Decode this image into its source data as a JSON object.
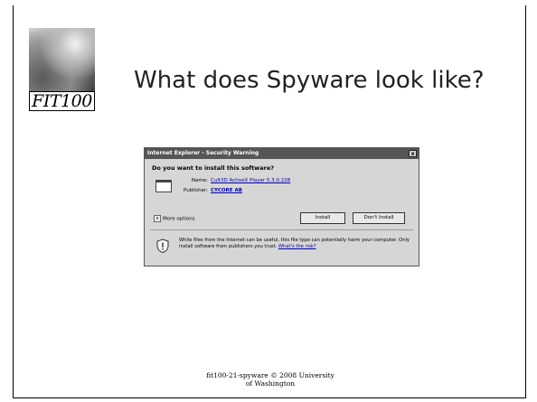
{
  "logo": {
    "text": "FIT100"
  },
  "slide": {
    "title": "What does Spyware look like?"
  },
  "dialog": {
    "title": "Internet Explorer - Security Warning",
    "close_label": "x",
    "question": "Do you want to install this software?",
    "name_label": "Name:",
    "name_value": "Cult3D ActiveX Player 5.3.0.228",
    "publisher_label": "Publisher:",
    "publisher_value": "CYCORE AB",
    "more_options": "More options",
    "install_button": "Install",
    "dont_install_button": "Don't Install",
    "warning_text": "While files from the Internet can be useful, this file type can potentially harm your computer. Only install software from publishers you trust.",
    "risk_link": "What's the risk?"
  },
  "footer": {
    "line1": "fit100-21-spyware © 2008 University",
    "line2": "of Washington"
  }
}
